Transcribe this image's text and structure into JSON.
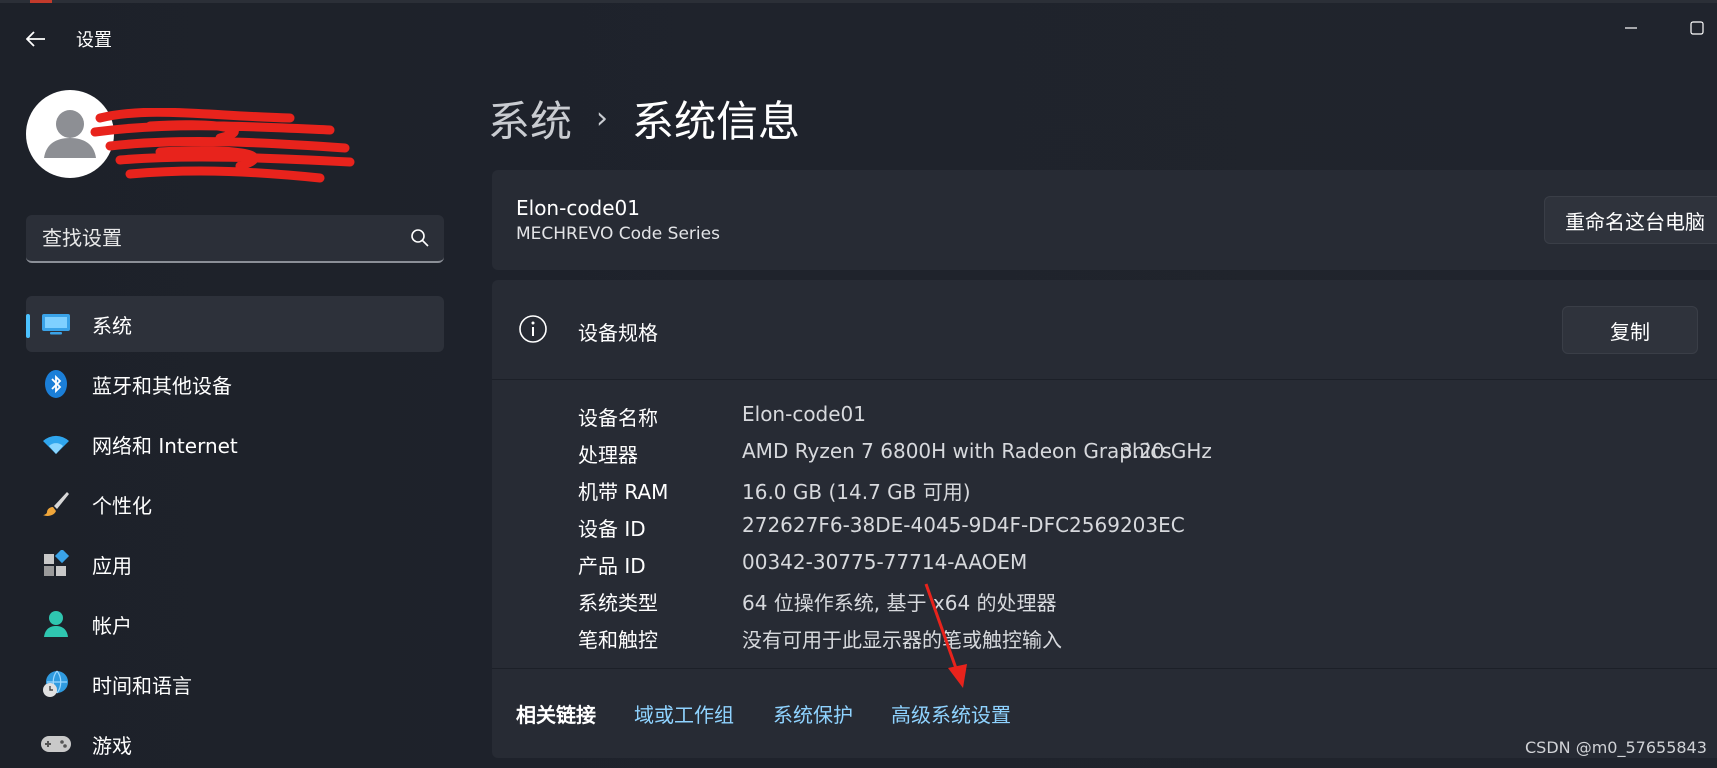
{
  "window": {
    "title": "设置",
    "controls": {
      "minimize": "minimize-icon",
      "maximize": "maximize-icon"
    }
  },
  "search": {
    "placeholder": "查找设置"
  },
  "sidebar": {
    "items": [
      {
        "label": "系统",
        "icon": "display-icon",
        "active": true
      },
      {
        "label": "蓝牙和其他设备",
        "icon": "bluetooth-icon"
      },
      {
        "label": "网络和 Internet",
        "icon": "wifi-icon"
      },
      {
        "label": "个性化",
        "icon": "brush-icon"
      },
      {
        "label": "应用",
        "icon": "apps-icon"
      },
      {
        "label": "帐户",
        "icon": "account-icon"
      },
      {
        "label": "时间和语言",
        "icon": "globe-clock-icon"
      },
      {
        "label": "游戏",
        "icon": "gamepad-icon"
      }
    ]
  },
  "breadcrumb": {
    "parent": "系统",
    "separator": "›",
    "current": "系统信息"
  },
  "device": {
    "name": "Elon-code01",
    "model": "MECHREVO Code Series",
    "rename_label": "重命名这台电脑"
  },
  "specs": {
    "title": "设备规格",
    "copy_label": "复制",
    "rows": [
      {
        "key": "设备名称",
        "value": "Elon-code01",
        "extra": ""
      },
      {
        "key": "处理器",
        "value": "AMD Ryzen 7 6800H with Radeon Graphics",
        "extra": "3.20 GHz"
      },
      {
        "key": "机带 RAM",
        "value": "16.0 GB (14.7 GB 可用)",
        "extra": ""
      },
      {
        "key": "设备 ID",
        "value": "272627F6-38DE-4045-9D4F-DFC2569203EC",
        "extra": ""
      },
      {
        "key": "产品 ID",
        "value": "00342-30775-77714-AAOEM",
        "extra": ""
      },
      {
        "key": "系统类型",
        "value": "64 位操作系统, 基于 x64 的处理器",
        "extra": ""
      },
      {
        "key": "笔和触控",
        "value": "没有可用于此显示器的笔或触控输入",
        "extra": ""
      }
    ]
  },
  "related_links": {
    "label": "相关链接",
    "links": [
      "域或工作组",
      "系统保护",
      "高级系统设置"
    ]
  },
  "watermark": "CSDN @m0_57655843",
  "colors": {
    "accent": "#4cc2ff",
    "link": "#8fd3ff",
    "background": "#1f232c",
    "card": "#272b34",
    "annotation": "#e8231c"
  }
}
